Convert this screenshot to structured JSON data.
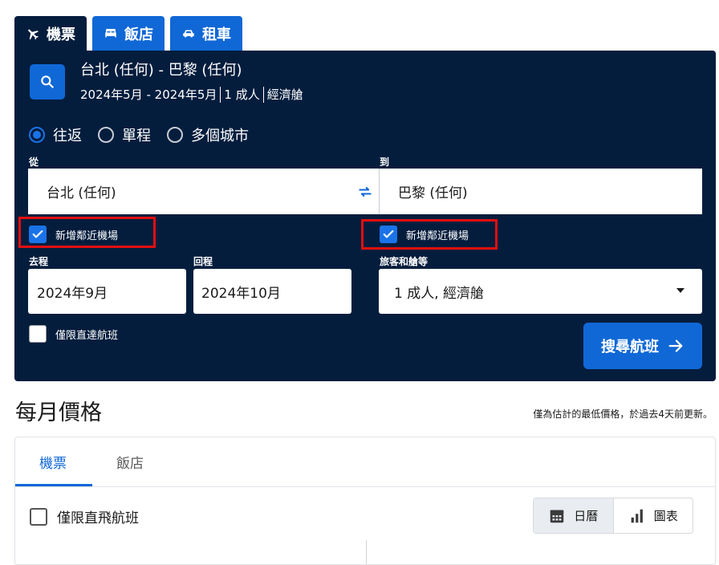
{
  "tabs": [
    {
      "label": "機票",
      "icon": "plane-icon",
      "active": true
    },
    {
      "label": "飯店",
      "icon": "bed-icon",
      "active": false
    },
    {
      "label": "租車",
      "icon": "car-icon",
      "active": false
    }
  ],
  "summary": {
    "route": "台北 (任何) - 巴黎 (任何)",
    "dates": "2024年5月 - 2024年5月",
    "travellers": "1 成人",
    "cabin": "經濟艙"
  },
  "trip_types": [
    {
      "label": "往返",
      "selected": true
    },
    {
      "label": "單程",
      "selected": false
    },
    {
      "label": "多個城市",
      "selected": false
    }
  ],
  "form": {
    "from_label": "從",
    "from_value": "台北 (任何)",
    "to_label": "到",
    "to_value": "巴黎 (任何)",
    "nearby_from_label": "新增鄰近機場",
    "nearby_from_checked": true,
    "nearby_to_label": "新增鄰近機場",
    "nearby_to_checked": true,
    "depart_label": "去程",
    "depart_value": "2024年9月",
    "return_label": "回程",
    "return_value": "2024年10月",
    "travellers_label": "旅客和艙等",
    "travellers_value": "1 成人, 經濟艙",
    "direct_label": "僅限直達航班",
    "direct_checked": false,
    "search_button": "搜尋航班"
  },
  "monthly": {
    "title": "每月價格",
    "note": "僅為估計的最低價格，於過去4天前更新。",
    "tabs": [
      {
        "label": "機票",
        "active": true
      },
      {
        "label": "飯店",
        "active": false
      }
    ],
    "direct_only_label": "僅限直飛航班",
    "view_calendar": "日曆",
    "view_chart": "圖表"
  },
  "colors": {
    "panel": "#051d3d",
    "accent": "#1068d6",
    "highlight": "#e10f0f"
  }
}
